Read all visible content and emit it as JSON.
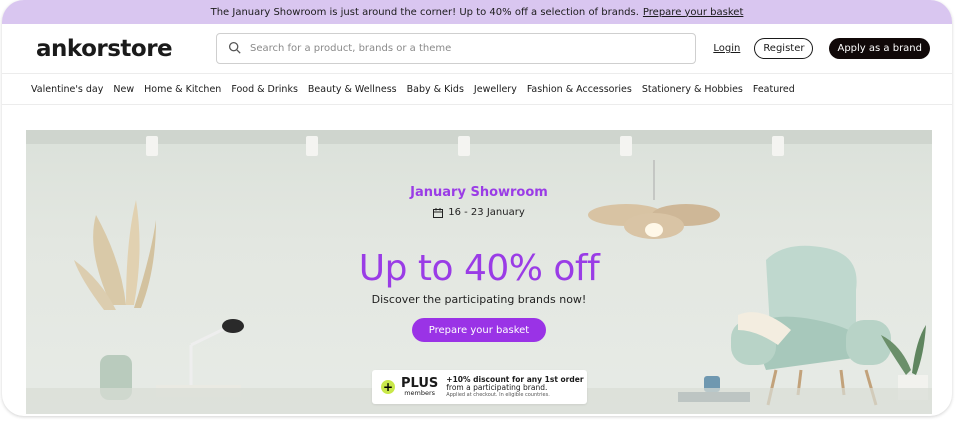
{
  "promo": {
    "text": "The January Showroom is just around the corner! Up to 40% off a selection of brands.",
    "link": "Prepare your basket"
  },
  "header": {
    "logo": "ankorstore",
    "search_placeholder": "Search for a product, brands or a theme",
    "login": "Login",
    "register": "Register",
    "apply": "Apply as a brand"
  },
  "nav": {
    "items": [
      "Valentine's day",
      "New",
      "Home & Kitchen",
      "Food & Drinks",
      "Beauty & Wellness",
      "Baby & Kids",
      "Jewellery",
      "Fashion & Accessories",
      "Stationery & Hobbies",
      "Featured"
    ]
  },
  "hero": {
    "eyebrow": "January Showroom",
    "dates": "16 - 23 January",
    "headline": "Up to 40% off",
    "subtitle": "Discover the participating brands now!",
    "cta": "Prepare your basket"
  },
  "plus": {
    "logo": "PLUS",
    "logo_sub": "members",
    "line1": "+10% discount for any 1st order",
    "line2": "from a participating brand.",
    "line3": "Applied at checkout. In eligible countries."
  },
  "colors": {
    "promo_bg": "#d9c6f0",
    "accent": "#9a33e6",
    "dark_button": "#100808",
    "plus_green": "#c9e84a"
  }
}
